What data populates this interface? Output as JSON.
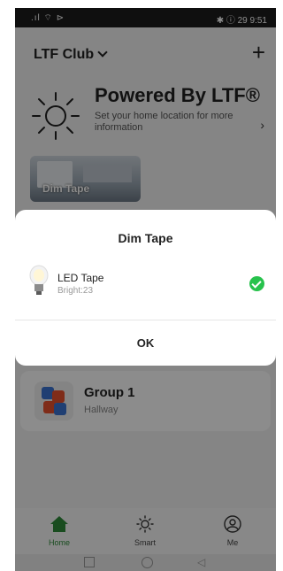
{
  "statusbar": {
    "left": ".ıl ⌔ ⊳",
    "right": "✱ ⓘ 29 9:51"
  },
  "header": {
    "club_name": "LTF Club",
    "add_symbol": "+"
  },
  "weather": {
    "title": "Powered By LTF®",
    "subtitle": "Set your home location for more information",
    "arrow": "›"
  },
  "scene": {
    "label": "Dim Tape"
  },
  "group": {
    "name": "Group 1",
    "room": "Hallway"
  },
  "tabs": [
    {
      "label": "Home",
      "icon": "home-icon",
      "active": true
    },
    {
      "label": "Smart",
      "icon": "sun-icon",
      "active": false
    },
    {
      "label": "Me",
      "icon": "user-icon",
      "active": false
    }
  ],
  "dialog": {
    "title": "Dim Tape",
    "device_name": "LED Tape",
    "device_status": "Bright:23",
    "ok_label": "OK"
  },
  "colors": {
    "accent": "#27c24c",
    "home_tab": "#2e8b3a",
    "overlay": "rgba(0,0,0,0.45)"
  }
}
